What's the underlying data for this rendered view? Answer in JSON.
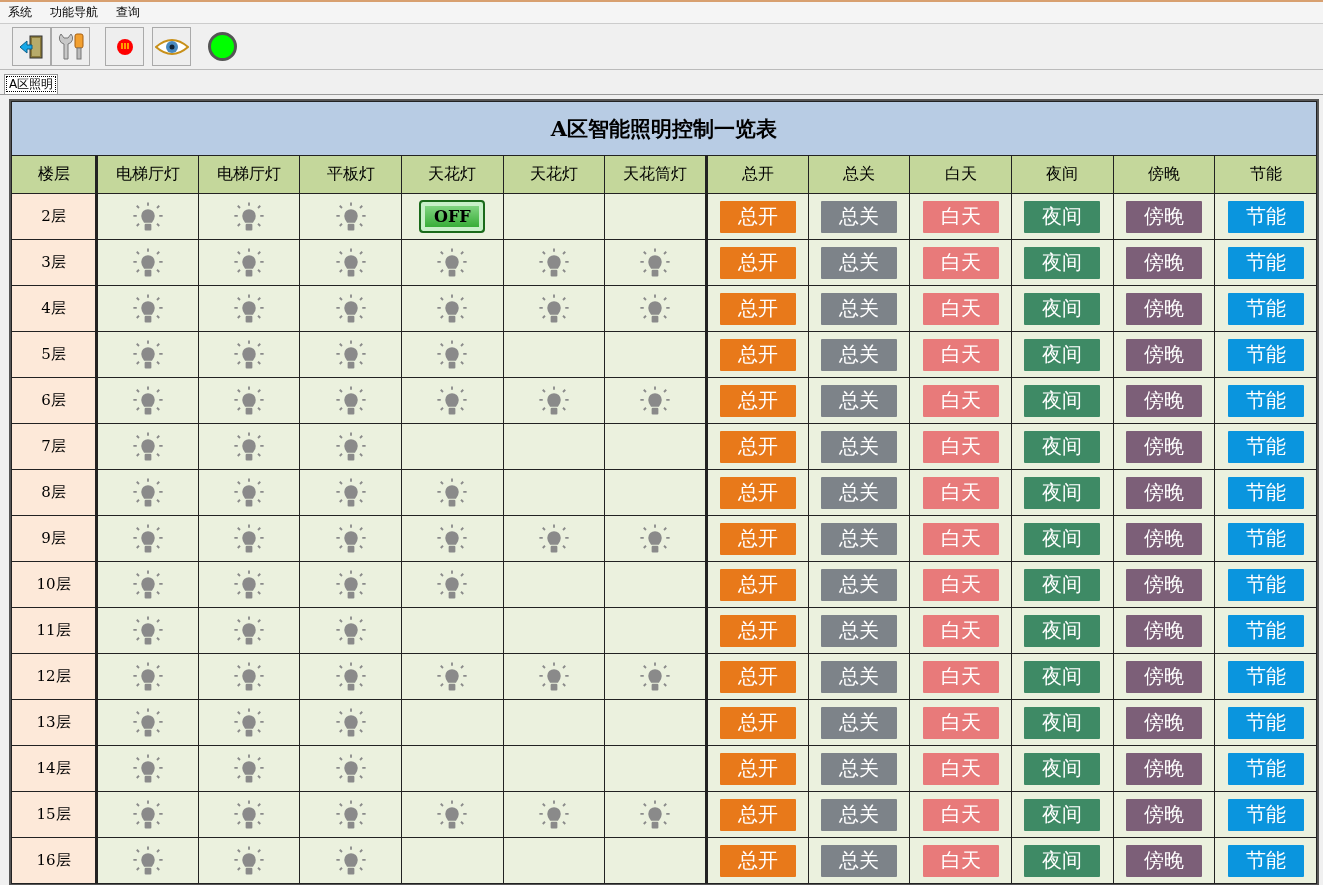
{
  "menu": [
    "系统",
    "功能导航",
    "查询"
  ],
  "toolbar": [
    {
      "kind": "exit"
    },
    {
      "kind": "tools"
    },
    {
      "kind": "alarm"
    },
    {
      "kind": "eye"
    }
  ],
  "status_light": {
    "color": "#00ff00"
  },
  "tabs": [
    {
      "label": "A区照明",
      "selected": true
    }
  ],
  "table": {
    "title": "A区智能照明控制一览表",
    "floor_column": "楼层",
    "lamp_columns": [
      "电梯厅灯",
      "电梯厅灯",
      "平板灯",
      "天花灯",
      "天花灯",
      "天花筒灯"
    ],
    "action_columns": [
      {
        "label": "总开",
        "color": "#e8791a"
      },
      {
        "label": "总关",
        "color": "#7d8389"
      },
      {
        "label": "白天",
        "color": "#e87a7a"
      },
      {
        "label": "夜间",
        "color": "#3e8a65"
      },
      {
        "label": "傍晚",
        "color": "#7c5f78"
      },
      {
        "label": "节能",
        "color": "#0a95de"
      }
    ],
    "rows": [
      {
        "floor": "2层",
        "lamps": [
          {
            "kind": "bulb"
          },
          {
            "kind": "bulb"
          },
          {
            "kind": "bulb"
          },
          {
            "kind": "switch",
            "label": "OFF",
            "on": false
          },
          {
            "kind": "empty"
          },
          {
            "kind": "empty"
          }
        ],
        "actions": [
          "总开",
          "总关",
          "白天",
          "夜间",
          "傍晚",
          "节能"
        ]
      },
      {
        "floor": "3层",
        "lamps": [
          {
            "kind": "bulb"
          },
          {
            "kind": "bulb"
          },
          {
            "kind": "bulb"
          },
          {
            "kind": "bulb"
          },
          {
            "kind": "bulb"
          },
          {
            "kind": "bulb"
          }
        ],
        "actions": [
          "总开",
          "总关",
          "白天",
          "夜间",
          "傍晚",
          "节能"
        ]
      },
      {
        "floor": "4层",
        "lamps": [
          {
            "kind": "bulb"
          },
          {
            "kind": "bulb"
          },
          {
            "kind": "bulb"
          },
          {
            "kind": "bulb"
          },
          {
            "kind": "bulb"
          },
          {
            "kind": "bulb"
          }
        ],
        "actions": [
          "总开",
          "总关",
          "白天",
          "夜间",
          "傍晚",
          "节能"
        ]
      },
      {
        "floor": "5层",
        "lamps": [
          {
            "kind": "bulb"
          },
          {
            "kind": "bulb"
          },
          {
            "kind": "bulb"
          },
          {
            "kind": "bulb"
          },
          {
            "kind": "empty"
          },
          {
            "kind": "empty"
          }
        ],
        "actions": [
          "总开",
          "总关",
          "白天",
          "夜间",
          "傍晚",
          "节能"
        ]
      },
      {
        "floor": "6层",
        "lamps": [
          {
            "kind": "bulb"
          },
          {
            "kind": "bulb"
          },
          {
            "kind": "bulb"
          },
          {
            "kind": "bulb"
          },
          {
            "kind": "bulb"
          },
          {
            "kind": "bulb"
          }
        ],
        "actions": [
          "总开",
          "总关",
          "白天",
          "夜间",
          "傍晚",
          "节能"
        ]
      },
      {
        "floor": "7层",
        "lamps": [
          {
            "kind": "bulb"
          },
          {
            "kind": "bulb"
          },
          {
            "kind": "bulb"
          },
          {
            "kind": "empty"
          },
          {
            "kind": "empty"
          },
          {
            "kind": "empty"
          }
        ],
        "actions": [
          "总开",
          "总关",
          "白天",
          "夜间",
          "傍晚",
          "节能"
        ]
      },
      {
        "floor": "8层",
        "lamps": [
          {
            "kind": "bulb"
          },
          {
            "kind": "bulb"
          },
          {
            "kind": "bulb"
          },
          {
            "kind": "bulb"
          },
          {
            "kind": "empty"
          },
          {
            "kind": "empty"
          }
        ],
        "actions": [
          "总开",
          "总关",
          "白天",
          "夜间",
          "傍晚",
          "节能"
        ]
      },
      {
        "floor": "9层",
        "lamps": [
          {
            "kind": "bulb"
          },
          {
            "kind": "bulb"
          },
          {
            "kind": "bulb"
          },
          {
            "kind": "bulb"
          },
          {
            "kind": "bulb"
          },
          {
            "kind": "bulb"
          }
        ],
        "actions": [
          "总开",
          "总关",
          "白天",
          "夜间",
          "傍晚",
          "节能"
        ]
      },
      {
        "floor": "10层",
        "lamps": [
          {
            "kind": "bulb"
          },
          {
            "kind": "bulb"
          },
          {
            "kind": "bulb"
          },
          {
            "kind": "bulb"
          },
          {
            "kind": "empty"
          },
          {
            "kind": "empty"
          }
        ],
        "actions": [
          "总开",
          "总关",
          "白天",
          "夜间",
          "傍晚",
          "节能"
        ]
      },
      {
        "floor": "11层",
        "lamps": [
          {
            "kind": "bulb"
          },
          {
            "kind": "bulb"
          },
          {
            "kind": "bulb"
          },
          {
            "kind": "empty"
          },
          {
            "kind": "empty"
          },
          {
            "kind": "empty"
          }
        ],
        "actions": [
          "总开",
          "总关",
          "白天",
          "夜间",
          "傍晚",
          "节能"
        ]
      },
      {
        "floor": "12层",
        "lamps": [
          {
            "kind": "bulb"
          },
          {
            "kind": "bulb"
          },
          {
            "kind": "bulb"
          },
          {
            "kind": "bulb"
          },
          {
            "kind": "bulb"
          },
          {
            "kind": "bulb"
          }
        ],
        "actions": [
          "总开",
          "总关",
          "白天",
          "夜间",
          "傍晚",
          "节能"
        ]
      },
      {
        "floor": "13层",
        "lamps": [
          {
            "kind": "bulb"
          },
          {
            "kind": "bulb"
          },
          {
            "kind": "bulb"
          },
          {
            "kind": "empty"
          },
          {
            "kind": "empty"
          },
          {
            "kind": "empty"
          }
        ],
        "actions": [
          "总开",
          "总关",
          "白天",
          "夜间",
          "傍晚",
          "节能"
        ]
      },
      {
        "floor": "14层",
        "lamps": [
          {
            "kind": "bulb"
          },
          {
            "kind": "bulb"
          },
          {
            "kind": "bulb"
          },
          {
            "kind": "empty"
          },
          {
            "kind": "empty"
          },
          {
            "kind": "empty"
          }
        ],
        "actions": [
          "总开",
          "总关",
          "白天",
          "夜间",
          "傍晚",
          "节能"
        ]
      },
      {
        "floor": "15层",
        "lamps": [
          {
            "kind": "bulb"
          },
          {
            "kind": "bulb"
          },
          {
            "kind": "bulb"
          },
          {
            "kind": "bulb"
          },
          {
            "kind": "bulb"
          },
          {
            "kind": "bulb"
          }
        ],
        "actions": [
          "总开",
          "总关",
          "白天",
          "夜间",
          "傍晚",
          "节能"
        ]
      },
      {
        "floor": "16层",
        "lamps": [
          {
            "kind": "bulb"
          },
          {
            "kind": "bulb"
          },
          {
            "kind": "bulb"
          },
          {
            "kind": "empty"
          },
          {
            "kind": "empty"
          },
          {
            "kind": "empty"
          }
        ],
        "actions": [
          "总开",
          "总关",
          "白天",
          "夜间",
          "傍晚",
          "节能"
        ]
      }
    ]
  }
}
